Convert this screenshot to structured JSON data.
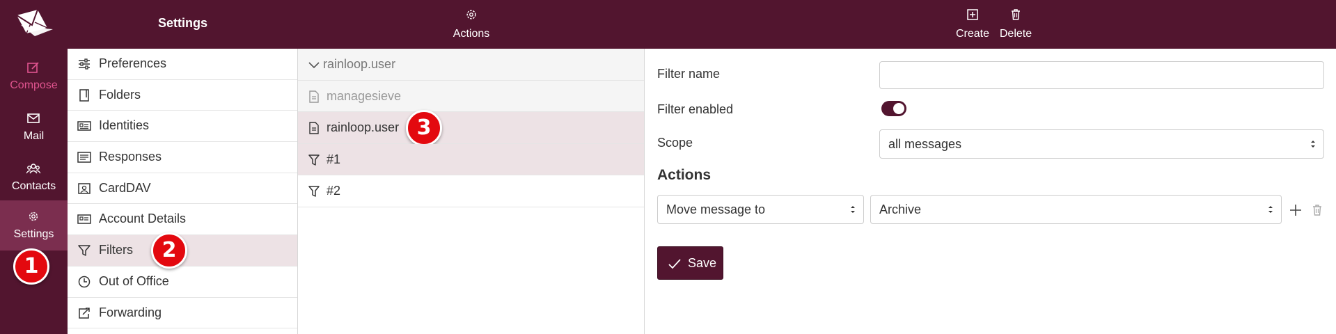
{
  "rail": {
    "items": [
      {
        "label": "Compose",
        "icon": "compose-icon"
      },
      {
        "label": "Mail",
        "icon": "mail-icon"
      },
      {
        "label": "Contacts",
        "icon": "contacts-icon"
      },
      {
        "label": "Settings",
        "icon": "gear-icon"
      }
    ]
  },
  "badges": {
    "one": "1",
    "two": "2",
    "three": "3"
  },
  "settings": {
    "title": "Settings",
    "items": [
      {
        "label": "Preferences"
      },
      {
        "label": "Folders"
      },
      {
        "label": "Identities"
      },
      {
        "label": "Responses"
      },
      {
        "label": "CardDAV"
      },
      {
        "label": "Account Details"
      },
      {
        "label": "Filters"
      },
      {
        "label": "Out of Office"
      },
      {
        "label": "Forwarding"
      }
    ]
  },
  "scripts": {
    "header_action": "Actions",
    "items": [
      {
        "label": "rainloop.user"
      },
      {
        "label": "managesieve"
      },
      {
        "label": "rainloop.user"
      },
      {
        "label": "#1"
      },
      {
        "label": "#2"
      }
    ]
  },
  "editor": {
    "create_label": "Create",
    "delete_label": "Delete",
    "filter_name_label": "Filter name",
    "filter_name_value": "",
    "filter_enabled_label": "Filter enabled",
    "filter_enabled": true,
    "scope_label": "Scope",
    "scope_value": "all messages",
    "actions_title": "Actions",
    "action_type_value": "Move message to",
    "action_target_value": "Archive",
    "save_label": "Save"
  },
  "colors": {
    "brand": "#52152f",
    "rail_active": "#7b2e4f",
    "compose_accent": "#e0548f",
    "selected_row": "#ede2e5",
    "badge": "#e3090f"
  }
}
